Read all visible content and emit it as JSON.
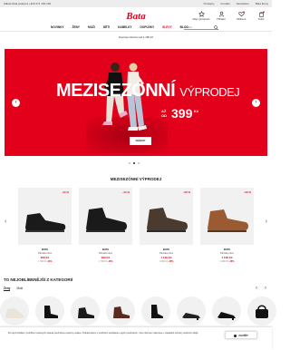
{
  "topbar": {
    "phone": "Zákaznická podpora +420 271 100 100",
    "links": [
      "Prodejny",
      "Kontakt",
      "Newsletter",
      "Bata Ikony"
    ]
  },
  "brand": {
    "logo": "Bata",
    "color": "#e2001a"
  },
  "utils": [
    {
      "icon": "club-icon",
      "label": "Moje výhodnosti"
    },
    {
      "icon": "user-icon",
      "label": "Přihlásit"
    },
    {
      "icon": "heart-icon",
      "label": "Oblíbené"
    },
    {
      "icon": "bag-icon",
      "label": "Košík"
    }
  ],
  "nav": {
    "items": [
      "NOVINKY",
      "ŽENY",
      "MUŽI",
      "DĚTI",
      "KABELKY",
      "DOPLŇKY",
      "SLEVY",
      "BLOG"
    ],
    "search_placeholder": "Hledat"
  },
  "promo": "Doprava zdarma nad 1 499 Kč",
  "hero": {
    "title": "MEZISEZÓNNÍ",
    "title_sub": "VÝPRODEJ",
    "price_prefix_1": "AŽ",
    "price_prefix_2": "OD",
    "price": "399",
    "currency": "Kč",
    "cta": "NÁKUP",
    "slide_count": 3,
    "active_slide": 2
  },
  "section_title": "MEZISEZÓNNÍ VÝPRODEJ",
  "products": [
    {
      "discount": "-44 %",
      "brand": "BATA",
      "name": "Pánská obuv",
      "price": "999 Kč",
      "orig": "1 799 Kč",
      "pct": "-44%",
      "color": "#1a1a1a"
    },
    {
      "discount": "-44 %",
      "brand": "BATA",
      "name": "Pánská obuv",
      "price": "999 Kč",
      "orig": "1 799 Kč",
      "pct": "-44%",
      "color": "#1a1a1a"
    },
    {
      "discount": "-30 %",
      "brand": "BATA",
      "name": "Pánská obuv",
      "price": "1 199 Kč",
      "orig": "1 699 Kč",
      "pct": "-30%",
      "color": "#4a3b2e"
    },
    {
      "discount": "-30 %",
      "brand": "BATA",
      "name": "Pánská obuv",
      "price": "1 199 Kč",
      "orig": "1 699 Kč",
      "pct": "-30%",
      "color": "#9a5a32"
    }
  ],
  "categories": {
    "title": "TO NEJOBLÍBENĚJŠÍ Z KATEGORIÍ",
    "tabs": [
      "Ženy",
      "Muži"
    ],
    "active_tab": "Ženy"
  },
  "cookie": {
    "text": "Pro lepší zážitek z prohlížení webových stránek používáme soubory cookies. Pokračováním v prohlížení souhlasíte s jejich používáním. Více informací naleznete v zásadách ochrany osobních údajů.",
    "button": "ZAVŘÍT"
  }
}
